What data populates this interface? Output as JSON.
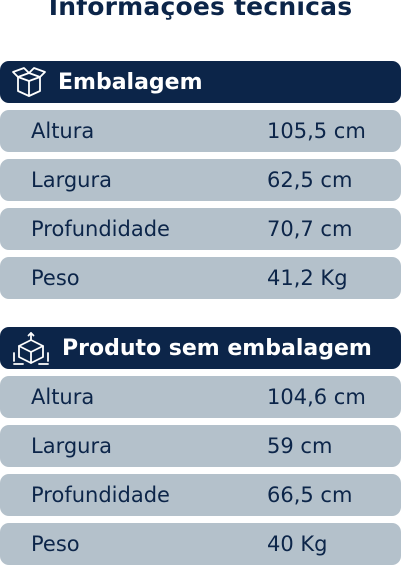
{
  "title": "Informações técnicas",
  "sections": [
    {
      "heading": "Embalagem",
      "icon": "open-box-icon",
      "rows": [
        {
          "label": "Altura",
          "value": "105,5 cm"
        },
        {
          "label": "Largura",
          "value": "62,5 cm"
        },
        {
          "label": "Profundidade",
          "value": "70,7 cm"
        },
        {
          "label": "Peso",
          "value": "41,2 Kg"
        }
      ]
    },
    {
      "heading": "Produto sem embalagem",
      "icon": "cube-dimensions-icon",
      "rows": [
        {
          "label": "Altura",
          "value": "104,6 cm"
        },
        {
          "label": "Largura",
          "value": "59 cm"
        },
        {
          "label": "Profundidade",
          "value": "66,5 cm"
        },
        {
          "label": "Peso",
          "value": "40 Kg"
        }
      ]
    }
  ],
  "colors": {
    "navy": "#0c2549",
    "row_bg": "#b4c1cb",
    "background": "#ffffff"
  }
}
